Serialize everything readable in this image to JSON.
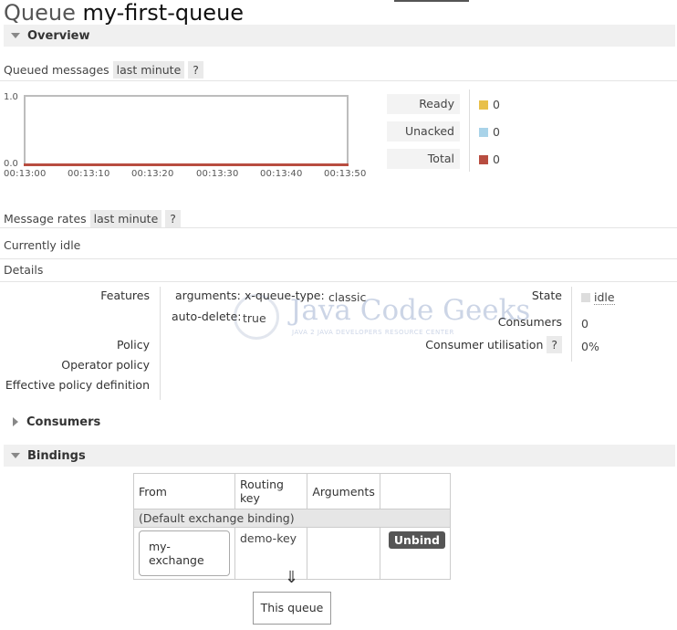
{
  "title": {
    "prefix": "Queue",
    "name": "my-first-queue"
  },
  "overview": {
    "header": "Overview",
    "queued_messages": {
      "label": "Queued messages",
      "range": "last minute",
      "help": "?",
      "y_top": "1.0",
      "y_bottom": "0.0",
      "x_ticks": [
        "00:13:00",
        "00:13:10",
        "00:13:20",
        "00:13:30",
        "00:13:40",
        "00:13:50"
      ],
      "legend": [
        {
          "label": "Ready",
          "value": "0",
          "color": "#e8c04a"
        },
        {
          "label": "Unacked",
          "value": "0",
          "color": "#a9d3e9"
        },
        {
          "label": "Total",
          "value": "0",
          "color": "#b84d40"
        }
      ]
    },
    "message_rates": {
      "label": "Message rates",
      "range": "last minute",
      "help": "?"
    },
    "status_text": "Currently idle",
    "details_label": "Details"
  },
  "details": {
    "features_label": "Features",
    "arguments_key": "arguments:",
    "x_queue_type_key": "x-queue-type:",
    "x_queue_type_value": "classic",
    "auto_delete_key": "auto-delete:",
    "auto_delete_value": "true",
    "policy_label": "Policy",
    "operator_policy_label": "Operator policy",
    "effective_policy_label": "Effective policy definition",
    "state_label": "State",
    "state_value": "idle",
    "consumers_label": "Consumers",
    "consumers_value": "0",
    "consumer_util_label": "Consumer utilisation",
    "consumer_util_help": "?",
    "consumer_util_value": "0%"
  },
  "watermark": {
    "text": "Java Code Geeks",
    "sub": "JAVA 2 JAVA DEVELOPERS RESOURCE CENTER"
  },
  "consumers_section": {
    "header": "Consumers"
  },
  "bindings": {
    "header": "Bindings",
    "columns": [
      "From",
      "Routing key",
      "Arguments",
      ""
    ],
    "default_binding": "(Default exchange binding)",
    "rows": [
      {
        "from": "my-exchange",
        "routing_key": "demo-key",
        "arguments": "",
        "action": "Unbind"
      }
    ],
    "arrow": "⇓",
    "this_queue": "This queue"
  }
}
